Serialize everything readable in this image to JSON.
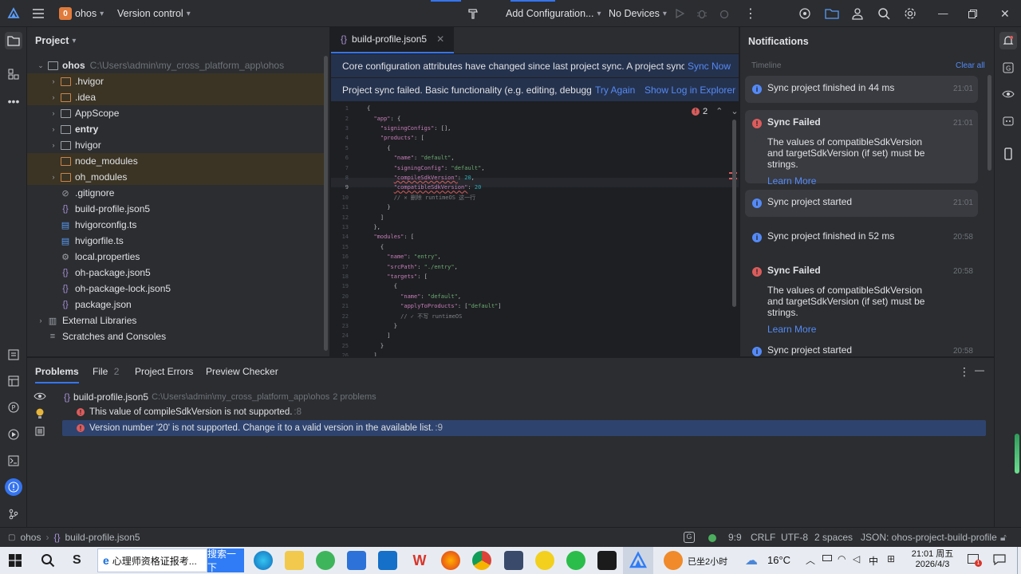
{
  "titlebar": {
    "project_badge": "0",
    "project_name": "ohos",
    "vcs": "Version control",
    "run_config": "Add Configuration...",
    "devices": "No Devices"
  },
  "project_panel": {
    "title": "Project",
    "root": {
      "name": "ohos",
      "path": "C:\\Users\\admin\\my_cross_platform_app\\ohos"
    },
    "items": [
      {
        "label": ".hvigor"
      },
      {
        "label": ".idea"
      },
      {
        "label": "AppScope"
      },
      {
        "label": "entry"
      },
      {
        "label": "hvigor"
      },
      {
        "label": "node_modules"
      },
      {
        "label": "oh_modules"
      },
      {
        "label": ".gitignore"
      },
      {
        "label": "build-profile.json5"
      },
      {
        "label": "hvigorconfig.ts"
      },
      {
        "label": "hvigorfile.ts"
      },
      {
        "label": "local.properties"
      },
      {
        "label": "oh-package.json5"
      },
      {
        "label": "oh-package-lock.json5"
      },
      {
        "label": "package.json"
      },
      {
        "label": "External Libraries"
      },
      {
        "label": "Scratches and Consoles"
      }
    ]
  },
  "editor": {
    "tab": "build-profile.json5",
    "banner1_text": "Core configuration attributes have changed since last project sync. A project sync may be",
    "banner1_link": "Sync Now",
    "banner2_text": "Project sync failed. Basic functionality (e.g. editing, debugging) w",
    "banner2_link1": "Try Again",
    "banner2_link2": "Show Log in Explorer",
    "error_count": "2",
    "lines": [
      "{",
      "  \"app\": {",
      "    \"signingConfigs\": [],",
      "    \"products\": [",
      "      {",
      "        \"name\": \"default\",",
      "        \"signingConfig\": \"default\",",
      "        \"compileSdkVersion\": 20,",
      "        \"compatibleSdkVersion\": 20",
      "        // ✕ 删除 runtimeOS 这一行",
      "      }",
      "    ]",
      "  },",
      "  \"modules\": [",
      "    {",
      "      \"name\": \"entry\",",
      "      \"srcPath\": \"./entry\",",
      "      \"targets\": [",
      "        {",
      "          \"name\": \"default\",",
      "          \"applyToProducts\": [\"default\"]",
      "          // ✓ 不写 runtimeOS",
      "        }",
      "      ]",
      "    }",
      "  ]"
    ],
    "line_numbers": [
      "1",
      "2",
      "3",
      "4",
      "5",
      "6",
      "7",
      "8",
      "9",
      "10",
      "11",
      "12",
      "13",
      "14",
      "15",
      "16",
      "17",
      "18",
      "19",
      "20",
      "21",
      "22",
      "23",
      "24",
      "25",
      "26"
    ]
  },
  "notifications": {
    "title": "Notifications",
    "timeline": "Timeline",
    "clear_all": "Clear all",
    "items": [
      {
        "title": "Sync project finished in 44 ms",
        "time": "21:01"
      },
      {
        "title": "Sync Failed",
        "time": "21:01",
        "body": "The values of compatibleSdkVersion and targetSdkVersion (if set) must be strings.",
        "link": "Learn More"
      },
      {
        "title": "Sync project started",
        "time": "21:01"
      },
      {
        "title": "Sync project finished in 52 ms",
        "time": "20:58"
      },
      {
        "title": "Sync Failed",
        "time": "20:58",
        "body": "The values of compatibleSdkVersion and targetSdkVersion (if set) must be strings.",
        "link": "Learn More"
      },
      {
        "title": "Sync project started",
        "time": "20:58"
      }
    ]
  },
  "problems": {
    "tabs": [
      "Problems",
      "File",
      "Project Errors",
      "Preview Checker"
    ],
    "file_count": "2",
    "file_name": "build-profile.json5",
    "file_path": "C:\\Users\\admin\\my_cross_platform_app\\ohos",
    "file_problems": "2 problems",
    "errors": [
      {
        "text": "This value of compileSdkVersion is not supported.",
        "loc": ":8"
      },
      {
        "text": "Version number '20' is not supported. Change it to a valid version in the available list.",
        "loc": ":9"
      }
    ]
  },
  "statusbar": {
    "crumb1": "ohos",
    "crumb2": "build-profile.json5",
    "position": "9:9",
    "line_sep": "CRLF",
    "encoding": "UTF-8",
    "indent": "2 spaces",
    "schema": "JSON: ohos-project-build-profile"
  },
  "taskbar": {
    "browser_tab": "心理师资格证报考...",
    "search_btn": "搜索一下",
    "weather_note": "已坐2小时",
    "temperature": "16°C",
    "ime": "中",
    "time": "21:01 周五",
    "date": "2026/4/3",
    "notif_badge": "1"
  },
  "colors": {
    "accent": "#3574f0",
    "error": "#db5c5c",
    "link": "#548af7",
    "banner": "#25324d",
    "selection": "#2e436e"
  }
}
